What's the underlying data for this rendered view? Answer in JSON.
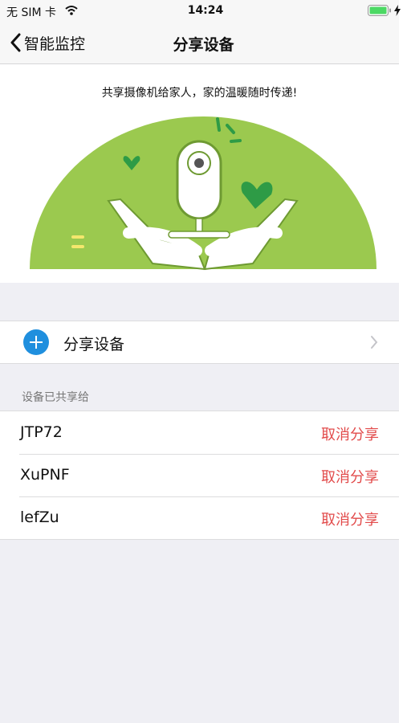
{
  "status_bar": {
    "carrier": "无 SIM 卡",
    "time": "14:24"
  },
  "nav": {
    "back_label": "智能监控",
    "title": "分享设备"
  },
  "banner": {
    "slogan": "共享摄像机给家人，家的温暖随时传递!"
  },
  "share_row": {
    "label": "分享设备"
  },
  "shared_section": {
    "header": "设备已共享给",
    "items": [
      {
        "name": "JTP72",
        "action": "取消分享"
      },
      {
        "name": "XuPNF",
        "action": "取消分享"
      },
      {
        "name": "lefZu",
        "action": "取消分享"
      }
    ]
  },
  "colors": {
    "accent_blue": "#1f8fde",
    "danger_red": "#e24b4b",
    "banner_green": "#9bc94f",
    "heart_green": "#2e9b46"
  }
}
